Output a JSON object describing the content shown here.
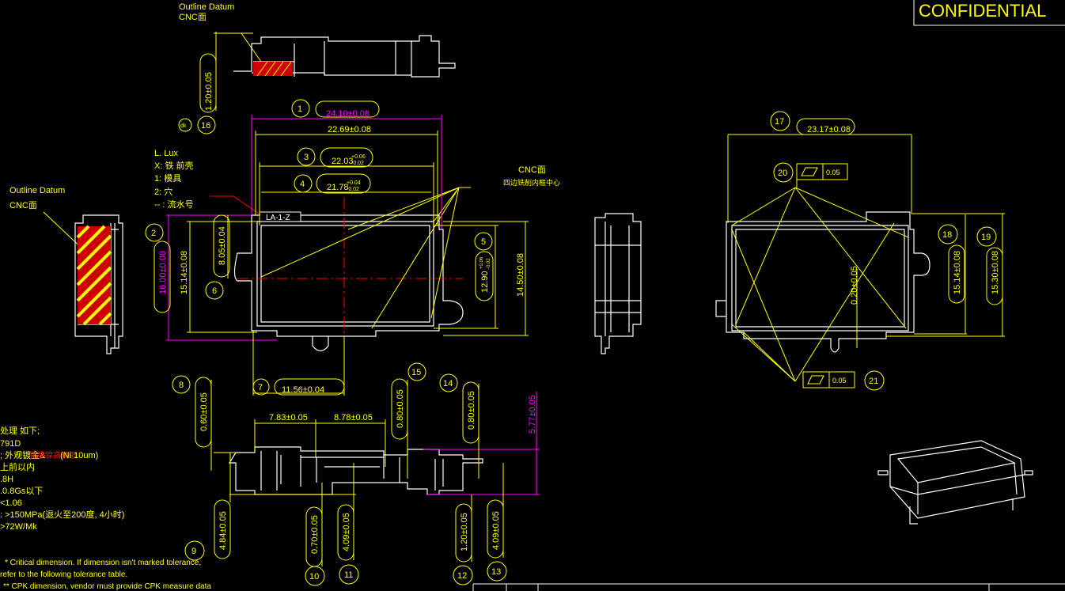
{
  "colors": {
    "background": "#000000",
    "dimension": "#ffff00",
    "geometry": "#ffffff",
    "critical": "#ff00ff",
    "datum": "#ff0000"
  },
  "stamp": "CONFIDENTIAL",
  "labels": {
    "outline_datum_top": "Outline Datum",
    "cnc_top": "CNC面",
    "outline_datum_left": "Outline Datum",
    "cnc_left": "CNC面",
    "cnc_right_1": "CNC面",
    "cnc_right_2": "四边铣削内框中心",
    "part_mark": "LA-1-Z",
    "legend": [
      "L. Lux",
      "X: 铁 前壳",
      "1: 模具",
      "2: 穴",
      "-- : 流水号"
    ],
    "dk": "dk"
  },
  "dimensions": [
    {
      "id": "1",
      "value": "24.10±0.08"
    },
    {
      "id": "",
      "value": "22.69±0.08"
    },
    {
      "id": "3",
      "value": "22.03",
      "tol_plus": "+0.06",
      "tol_minus": "-0.02"
    },
    {
      "id": "4",
      "value": "21.78",
      "tol_plus": "+0.04",
      "tol_minus": "-0.02"
    },
    {
      "id": "2",
      "value": "16.00±0.08"
    },
    {
      "id": "",
      "value": "15.14±0.08"
    },
    {
      "id": "6",
      "value": "8.05±0.04"
    },
    {
      "id": "5",
      "value": "12.90",
      "tol_plus": "+0.06",
      "tol_minus": "-0.02"
    },
    {
      "id": "",
      "value": "14.50±0.08"
    },
    {
      "id": "7",
      "value": "11.56±0.04"
    },
    {
      "id": "16",
      "value": "1.20±0.05"
    },
    {
      "id": "17",
      "value": "23.17±0.08"
    },
    {
      "id": "18",
      "value": "15.14±0.08"
    },
    {
      "id": "19",
      "value": "15.30±0.08"
    },
    {
      "id": "",
      "value": "0.20±0.05"
    },
    {
      "id": "20",
      "value": "0.05"
    },
    {
      "id": "21",
      "value": "0.05"
    },
    {
      "id": "8",
      "value": "0.60±0.05"
    },
    {
      "id": "",
      "value": "7.83±0.05"
    },
    {
      "id": "",
      "value": "8.78±0.05"
    },
    {
      "id": "15",
      "value": "0.80±0.05"
    },
    {
      "id": "14",
      "value": "0.80±0.05"
    },
    {
      "id": "",
      "value": "5.77±0.05"
    },
    {
      "id": "9",
      "value": "4.84±0.05"
    },
    {
      "id": "10",
      "value": "0.70±0.05"
    },
    {
      "id": "11",
      "value": "4.09±0.05"
    },
    {
      "id": "12",
      "value": "1.20±0.05"
    },
    {
      "id": "13",
      "value": "4.09±0.05"
    }
  ],
  "notes": {
    "lines": [
      "处理 如下;",
      "791D",
      "; 外观镀金&",
      "(Ni 10um)",
      "上前以内",
      ".8H",
      ".0.8Gs以下",
      "<1.06",
      ": >150MPa(退火至200度, 4小时)",
      ">72W/Mk"
    ],
    "red_fragment": "化学镍高磷镀",
    "footnotes": [
      "* Critical dimension. If dimension isn't marked tolerance,",
      "refer to the following tolerance table.",
      "** CPK dimension, vendor must provide CPK measure data"
    ]
  }
}
